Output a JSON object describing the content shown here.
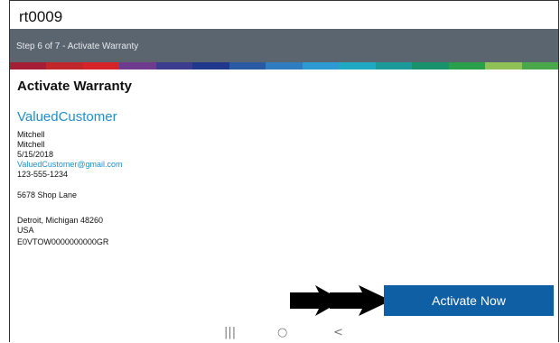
{
  "window": {
    "title": "rt0009"
  },
  "header": {
    "step_label": "Step 6 of 7 - Activate Warranty"
  },
  "brand_colors": [
    "#a51e36",
    "#c1262b",
    "#d6242a",
    "#6e3b8f",
    "#3d3d8f",
    "#20388c",
    "#2b5aa4",
    "#2f7cc1",
    "#2d9ad3",
    "#1fa9c3",
    "#1a9a9a",
    "#17926b",
    "#2ba04a",
    "#8fc157",
    "#4aa84a"
  ],
  "page": {
    "section_title": "Activate Warranty"
  },
  "customer": {
    "username": "ValuedCustomer",
    "first_name": "Mitchell",
    "last_name": "Mitchell",
    "date": "5/15/2018",
    "email": "ValuedCustomer@gmail.com",
    "phone": "123-555-1234",
    "street": "5678 Shop Lane",
    "city_state_zip": "Detroit, Michigan 48260",
    "country": "USA",
    "serial": "E0VTOW0000000000GR"
  },
  "actions": {
    "activate_label": "Activate Now"
  },
  "navigation": {
    "recents_icon": "|||",
    "home_icon": "○",
    "back_icon": "<"
  }
}
